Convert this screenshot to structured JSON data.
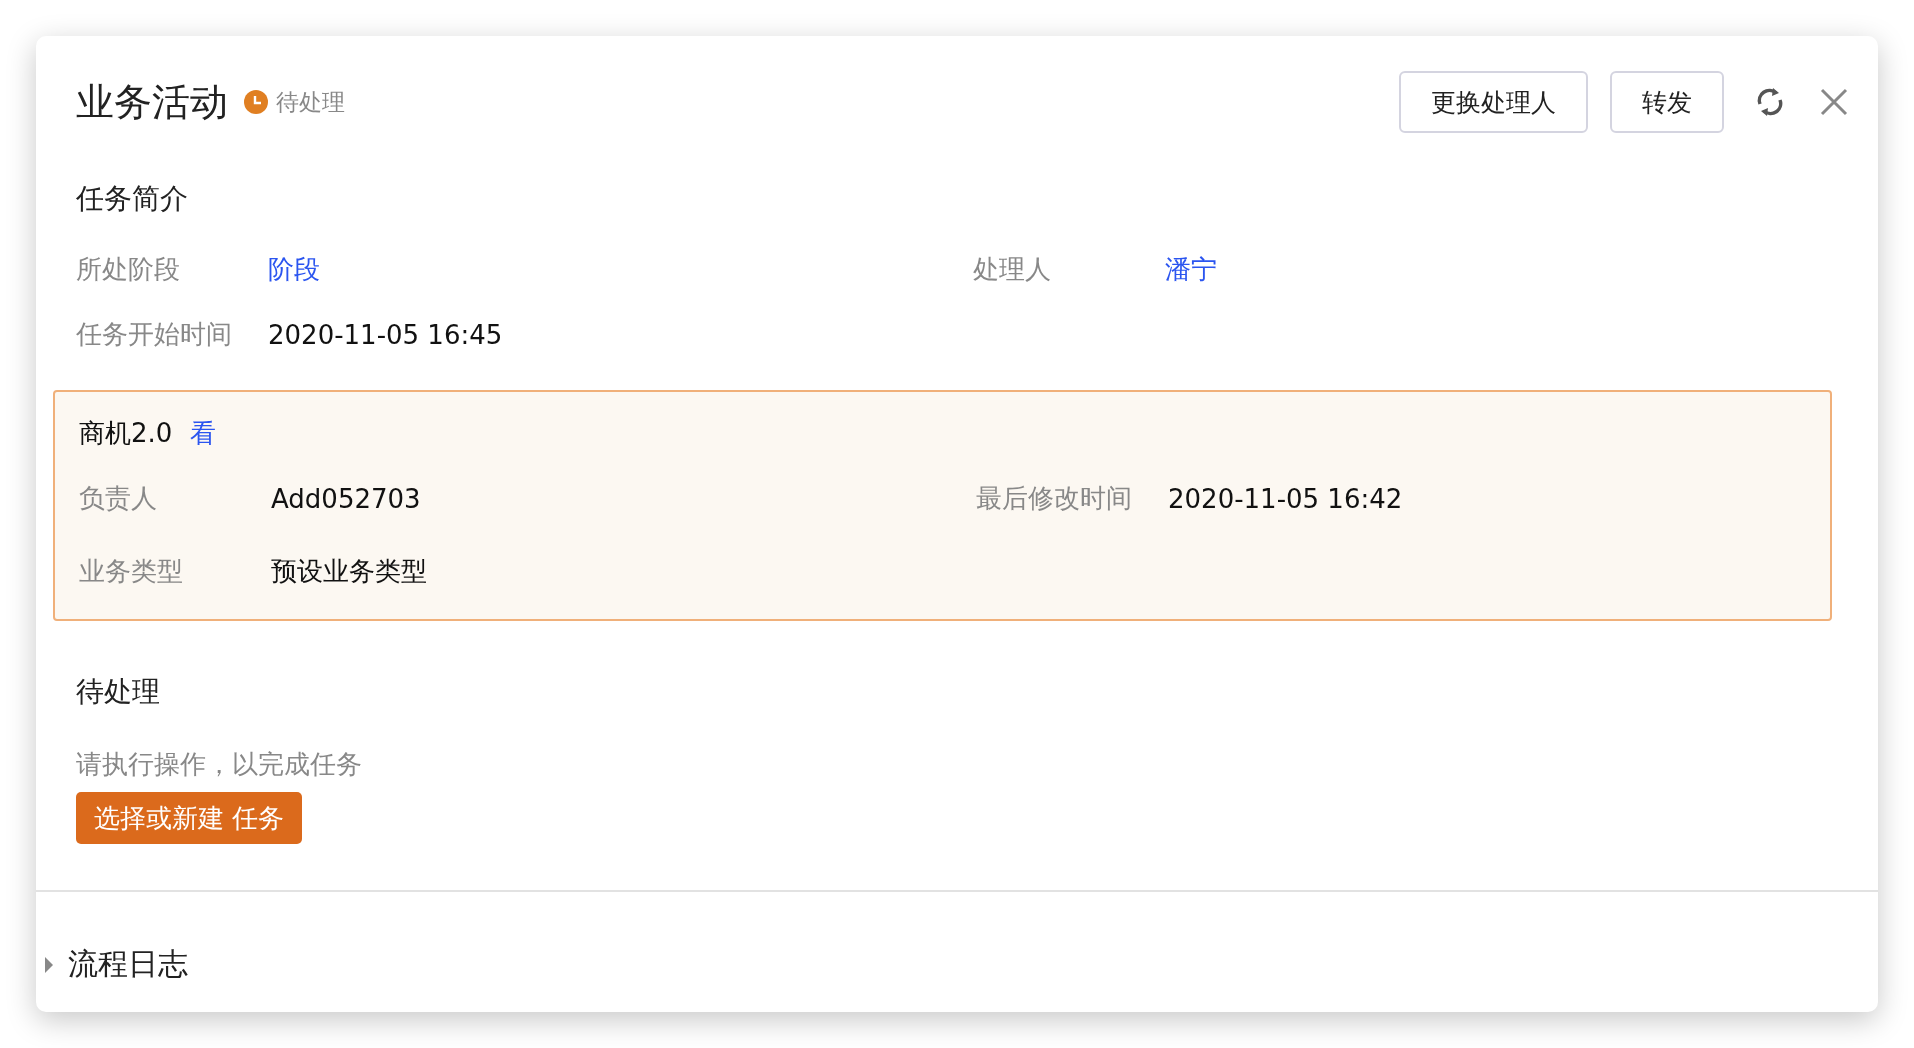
{
  "header": {
    "title": "业务活动",
    "status": "待处理",
    "buttons": [
      "更换处理人",
      "转发"
    ]
  },
  "summary": {
    "title": "任务简介",
    "fields": [
      {
        "label": "所处阶段",
        "value": "阶段",
        "kind": "link"
      },
      {
        "label": "处理人",
        "value": "潘宁",
        "kind": "link"
      },
      {
        "label": "任务开始时间",
        "value": "2020-11-05 16:45",
        "kind": "text"
      }
    ]
  },
  "record": {
    "title": "商机2.0",
    "link": "看",
    "fields": [
      {
        "label": "负责人",
        "value": "Add052703"
      },
      {
        "label": "最后修改时间",
        "value": "2020-11-05 16:42"
      },
      {
        "label": "业务类型",
        "value": "预设业务类型"
      }
    ]
  },
  "pending": {
    "title": "待处理",
    "hint": "请执行操作，以完成任务",
    "action": "选择或新建 任务"
  },
  "log": {
    "title": "流程日志",
    "expanded": false
  }
}
